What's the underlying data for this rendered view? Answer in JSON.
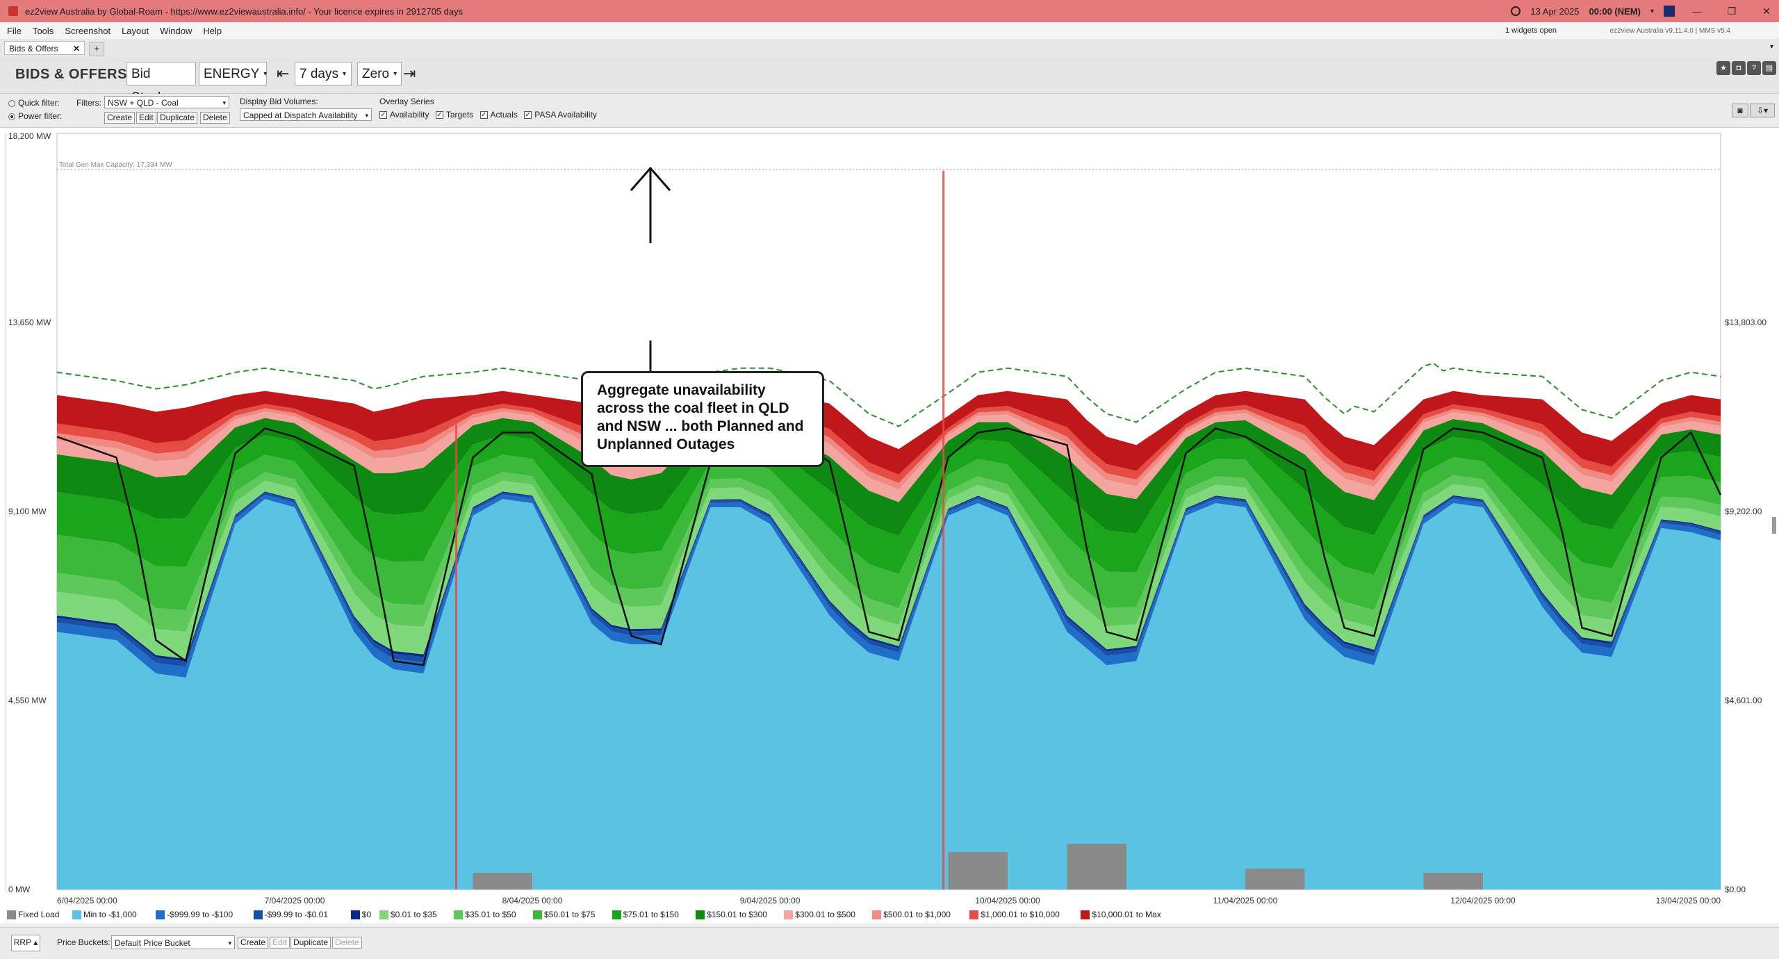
{
  "window": {
    "title": "ez2view Australia by Global-Roam - https://www.ez2viewaustralia.info/ - Your licence expires in 2912705 days",
    "datetime": "13 Apr 2025",
    "time_zone": "00:00 (NEM)",
    "minimize": "—",
    "restore": "❐",
    "close": "✕"
  },
  "menu": {
    "items": [
      "File",
      "Tools",
      "Screenshot",
      "Layout",
      "Window",
      "Help"
    ],
    "widgets_open": "1 widgets open",
    "version": "ez2view Australia v9.11.4.0 | MMS v5.4"
  },
  "tabs": {
    "active": "Bids & Offers",
    "close": "✕",
    "add": "+"
  },
  "toolbar": {
    "title": "BIDS & OFFERS",
    "view_select": "Bid Stack",
    "market_select": "ENERGY",
    "first_button": "⇤",
    "range_select": "7 days",
    "baseline_select": "Zero",
    "last_button": "⇥"
  },
  "filters": {
    "quick_filter": "Quick filter:",
    "power_filter": "Power filter:",
    "filters_label": "Filters:",
    "filter_value": "NSW + QLD - Coal",
    "create": "Create",
    "edit": "Edit",
    "duplicate": "Duplicate",
    "delete": "Delete",
    "display_bid_volumes_label": "Display Bid Volumes:",
    "display_bid_volumes_value": "Capped at Dispatch Availability",
    "overlay_series_label": "Overlay Series",
    "overlay_series": [
      {
        "label": "Availability",
        "checked": true
      },
      {
        "label": "Targets",
        "checked": true
      },
      {
        "label": "Actuals",
        "checked": true
      },
      {
        "label": "PASA Availability",
        "checked": true
      }
    ]
  },
  "chart_data": {
    "type": "area",
    "y_left_ticks": [
      "18,200 MW",
      "13,650 MW",
      "9,100 MW",
      "4,550 MW",
      "0 MW"
    ],
    "y_left_values": [
      18200,
      13650,
      9100,
      4550,
      0
    ],
    "y_right_ticks": [
      "$13,803.00",
      "$9,202.00",
      "$4,601.00",
      "$0.00"
    ],
    "y_right_values": [
      13803,
      9202,
      4601,
      0
    ],
    "ylim": [
      0,
      18200
    ],
    "x_ticks": [
      "6/04/2025 00:00",
      "7/04/2025 00:00",
      "8/04/2025 00:00",
      "9/04/2025 00:00",
      "10/04/2025 00:00",
      "11/04/2025 00:00",
      "12/04/2025 00:00",
      "13/04/2025 00:00"
    ],
    "xlim_days": [
      0,
      7
    ],
    "capacity_line": {
      "label": "Total Gen Max Capacity: 17,334 MW",
      "value": 17334
    },
    "spikes_days": [
      1.68,
      3.73
    ],
    "series": [
      {
        "name": "Fixed Load",
        "color": "#8a8a8a"
      },
      {
        "name": "Min to -$1,000",
        "color": "#5ac3e3"
      },
      {
        "name": "-$999.99 to -$100",
        "color": "#1f6fc9"
      },
      {
        "name": "-$99.99 to -$0.01",
        "color": "#1a4fa8"
      },
      {
        "name": "$0",
        "color": "#0a2a8a"
      },
      {
        "name": "$0.01 to $35",
        "color": "#7fd87a"
      },
      {
        "name": "$35.01 to $50",
        "color": "#5ec95a"
      },
      {
        "name": "$50.01 to $75",
        "color": "#3cb83a"
      },
      {
        "name": "$75.01 to $150",
        "color": "#1aa51a"
      },
      {
        "name": "$150.01 to $300",
        "color": "#0e8a12"
      },
      {
        "name": "$300.01 to $500",
        "color": "#f4a5a0"
      },
      {
        "name": "$500.01 to $1,000",
        "color": "#ef8a84"
      },
      {
        "name": "$1,000.01 to $10,000",
        "color": "#e44c44"
      },
      {
        "name": "$10,000.01 to Max",
        "color": "#c0181a"
      }
    ],
    "profiles_hours": {
      "hours": [
        0,
        6,
        8,
        10,
        13,
        18,
        21,
        24,
        30,
        32,
        34,
        37,
        42,
        45,
        48,
        54,
        56,
        58,
        61,
        66,
        69,
        72,
        78,
        80,
        82,
        85,
        90,
        93,
        96,
        102,
        104,
        106,
        109,
        114,
        117,
        120,
        126,
        128,
        130,
        133,
        138,
        141,
        144,
        150,
        152,
        154,
        157,
        162,
        165,
        168
      ],
      "min_to_1000_mw": [
        6200,
        6000,
        5600,
        5200,
        5100,
        8800,
        9400,
        9200,
        6200,
        5600,
        5300,
        5200,
        9000,
        9400,
        9300,
        6400,
        6000,
        5900,
        5900,
        9200,
        9200,
        8800,
        6600,
        6100,
        5700,
        5500,
        9000,
        9300,
        9000,
        6200,
        5800,
        5400,
        5500,
        9000,
        9300,
        9200,
        6500,
        6000,
        5600,
        5400,
        8800,
        9300,
        9200,
        6800,
        6200,
        5700,
        5600,
        8700,
        8600,
        8400
      ],
      "total_bid_mw": [
        11900,
        11700,
        11600,
        11500,
        11600,
        11900,
        12000,
        11900,
        11700,
        11500,
        11600,
        11800,
        11900,
        12000,
        11900,
        11700,
        11300,
        11200,
        11400,
        11900,
        12000,
        12000,
        11700,
        11300,
        10900,
        10600,
        11400,
        11900,
        12000,
        11800,
        11300,
        10900,
        10700,
        11500,
        11900,
        12000,
        11800,
        11300,
        10900,
        10700,
        11800,
        12000,
        11900,
        11800,
        11400,
        11000,
        10800,
        11700,
        11900,
        11800
      ],
      "actuals_mw": [
        10900,
        10400,
        8500,
        6000,
        5500,
        10500,
        11100,
        10900,
        10200,
        8000,
        5500,
        5400,
        10400,
        11000,
        11000,
        10000,
        7700,
        6100,
        5900,
        10300,
        11000,
        11200,
        10300,
        8300,
        6200,
        6000,
        10400,
        11000,
        11100,
        10700,
        8200,
        6200,
        6000,
        10500,
        11100,
        10900,
        10100,
        8000,
        6300,
        6100,
        10600,
        11100,
        11000,
        10400,
        8600,
        6300,
        6100,
        10400,
        11000,
        9500
      ]
    },
    "annotation": "Aggregate unavailability across the coal fleet in QLD and NSW ... both Planned and Unplanned Outages"
  },
  "bottom": {
    "rrp": "RRP ▴",
    "price_buckets_label": "Price Buckets:",
    "price_bucket_value": "Default Price Bucket",
    "create": "Create",
    "edit": "Edit",
    "duplicate": "Duplicate",
    "delete": "Delete"
  }
}
